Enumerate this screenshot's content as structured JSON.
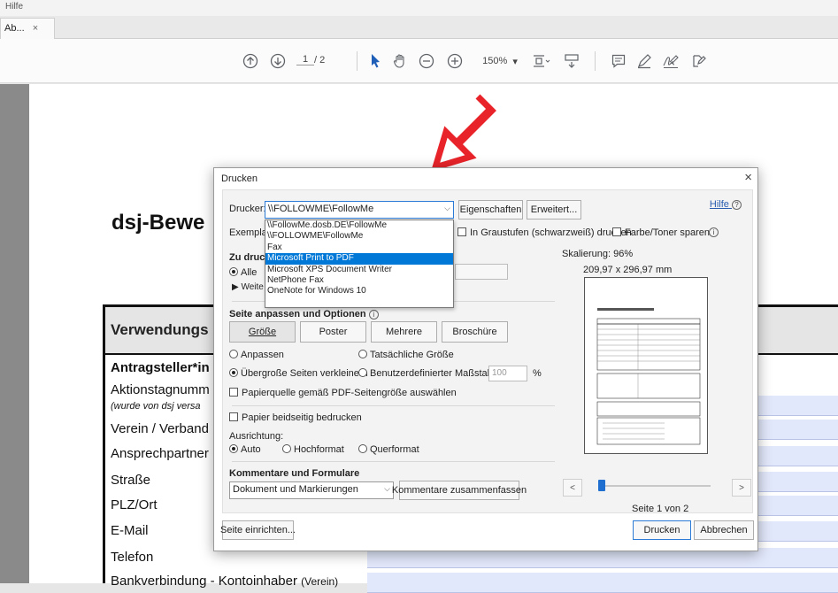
{
  "menubar": {
    "help": "Hilfe"
  },
  "tab": {
    "title": "Ab...",
    "close": "×"
  },
  "toolbar": {
    "page_current": "1",
    "page_total": "/ 2",
    "zoom": "150%",
    "zoom_chevron": "▾",
    "icons": [
      "arrow-up-circle",
      "arrow-down-circle",
      "select-cursor",
      "hand",
      "zoom-out",
      "zoom-in",
      "fit-page",
      "scroll-mode",
      "comment",
      "highlight",
      "sign",
      "fill-sign"
    ]
  },
  "document": {
    "title": "dsj-Bewe",
    "header": "Verwendungs",
    "rows": [
      "Antragsteller*in",
      "Aktionstagnumm",
      "(wurde von dsj versa",
      "Verein / Verband",
      "Ansprechpartner",
      "Straße",
      "PLZ/Ort",
      "E-Mail",
      "Telefon",
      "Bankverbindung - Kontoinhaber",
      "(Verein)"
    ]
  },
  "dialog": {
    "title": "Drucken",
    "close": "×",
    "help_link": "Hilfe",
    "help_icon": "?",
    "printer_label": "Drucker:",
    "printer_value": "\\\\FOLLOWME\\FollowMe",
    "properties_button": "Eigenschaften",
    "advanced_button": "Erweitert...",
    "copies_label": "Exempla",
    "grayscale_label": "In Graustufen (schwarzweiß) drucken",
    "save_toner_label": "Farbe/Toner sparen",
    "info_icon": "i",
    "printer_options": [
      "\\\\FollowMe.dosb.DE\\FollowMe",
      "\\\\FOLLOWME\\FollowMe",
      "Fax",
      "Microsoft Print to PDF",
      "Microsoft XPS Document Writer",
      "NetPhone Fax",
      "OneNote for Windows 10"
    ],
    "selected_option_index": 3,
    "pages_header": "Zu druck",
    "pages_all": "Alle",
    "pages_more": "▶ Weite",
    "fit_header": "Seite anpassen und Optionen",
    "fit_tabs": [
      "Größe",
      "Poster",
      "Mehrere",
      "Broschüre"
    ],
    "fit_options": {
      "fit": "Anpassen",
      "actual": "Tatsächliche Größe",
      "shrink": "Übergroße Seiten verkleinern",
      "custom": "Benutzerdefinierter Maßstab:",
      "custom_value": "100",
      "percent": "%"
    },
    "paper_source_label": "Papierquelle gemäß PDF-Seitengröße auswählen",
    "duplex_label": "Papier beidseitig bedrucken",
    "orientation_label": "Ausrichtung:",
    "orientation_options": [
      "Auto",
      "Hochformat",
      "Querformat"
    ],
    "comments_header": "Kommentare und Formulare",
    "comments_value": "Dokument und Markierungen",
    "summarize_button": "Kommentare zusammenfassen",
    "scale_label": "Skalierung: 96%",
    "page_size": "209,97 x 296,97 mm",
    "prev_button": "<",
    "next_button": ">",
    "page_indicator": "Seite 1 von 2",
    "setup_button": "Seite einrichten...",
    "print_button": "Drucken",
    "cancel_button": "Abbrechen"
  },
  "colors": {
    "accent": "#0078d7",
    "arrow": "#e8242a",
    "field": "#e2e8fb"
  }
}
